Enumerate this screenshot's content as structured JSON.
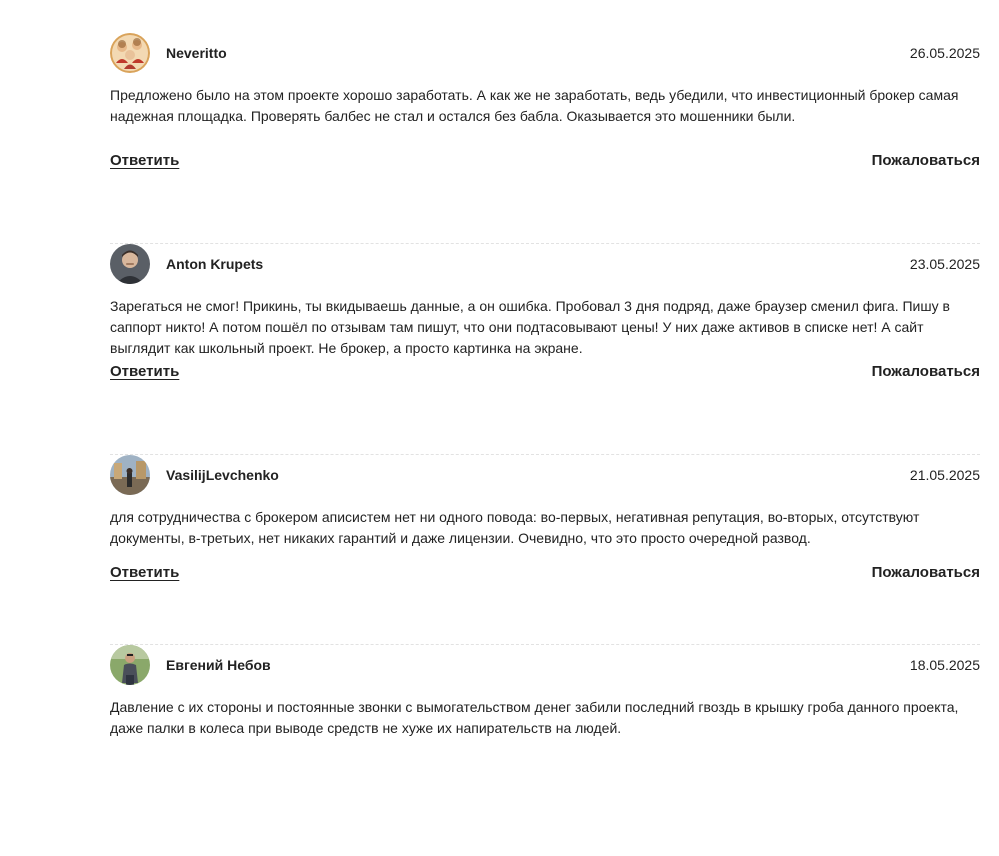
{
  "actions": {
    "reply_label": "Ответить",
    "complain_label": "Пожаловаться"
  },
  "reviews": [
    {
      "author": "Neveritto",
      "date": "26.05.2025",
      "avatar_icon": "illustrated-group-avatar",
      "text": "Предложено было на этом проекте хорошо заработать. А как же не заработать, ведь убедили, что инвестиционный брокер самая надежная площадка. Проверять балбес не стал и остался без бабла. Оказывается это мошенники были."
    },
    {
      "author": "Anton Krupets",
      "date": "23.05.2025",
      "avatar_icon": "man-portrait-avatar",
      "text": "Зарегаться не смог! Прикинь, ты вкидываешь данные, а он ошибка. Пробовал 3 дня подряд, даже браузер сменил фига. Пишу в саппорт никто! А потом пошёл по отзывам там пишут, что они подтасовывают цены! У них даже активов в списке нет! А сайт выглядит как школьный проект. Не брокер, а просто картинка на экране."
    },
    {
      "author": "VasilijLevchenko",
      "date": "21.05.2025",
      "avatar_icon": "street-photo-avatar",
      "text": "для сотрудничества с брокером аписистем нет ни одного повода: во-первых, негативная репутация, во-вторых, отсутствуют документы, в-третьих, нет никаких гарантий и даже лицензии. Очевидно, что это просто очередной развод."
    },
    {
      "author": "Евгений Небов",
      "date": "18.05.2025",
      "avatar_icon": "man-outdoor-avatar",
      "text": "Давление с их стороны и постоянные звонки с вымогательством денег забили последний гвоздь в крышку гроба данного проекта, даже палки в колеса при выводе средств не хуже их напирательств на людей."
    }
  ]
}
